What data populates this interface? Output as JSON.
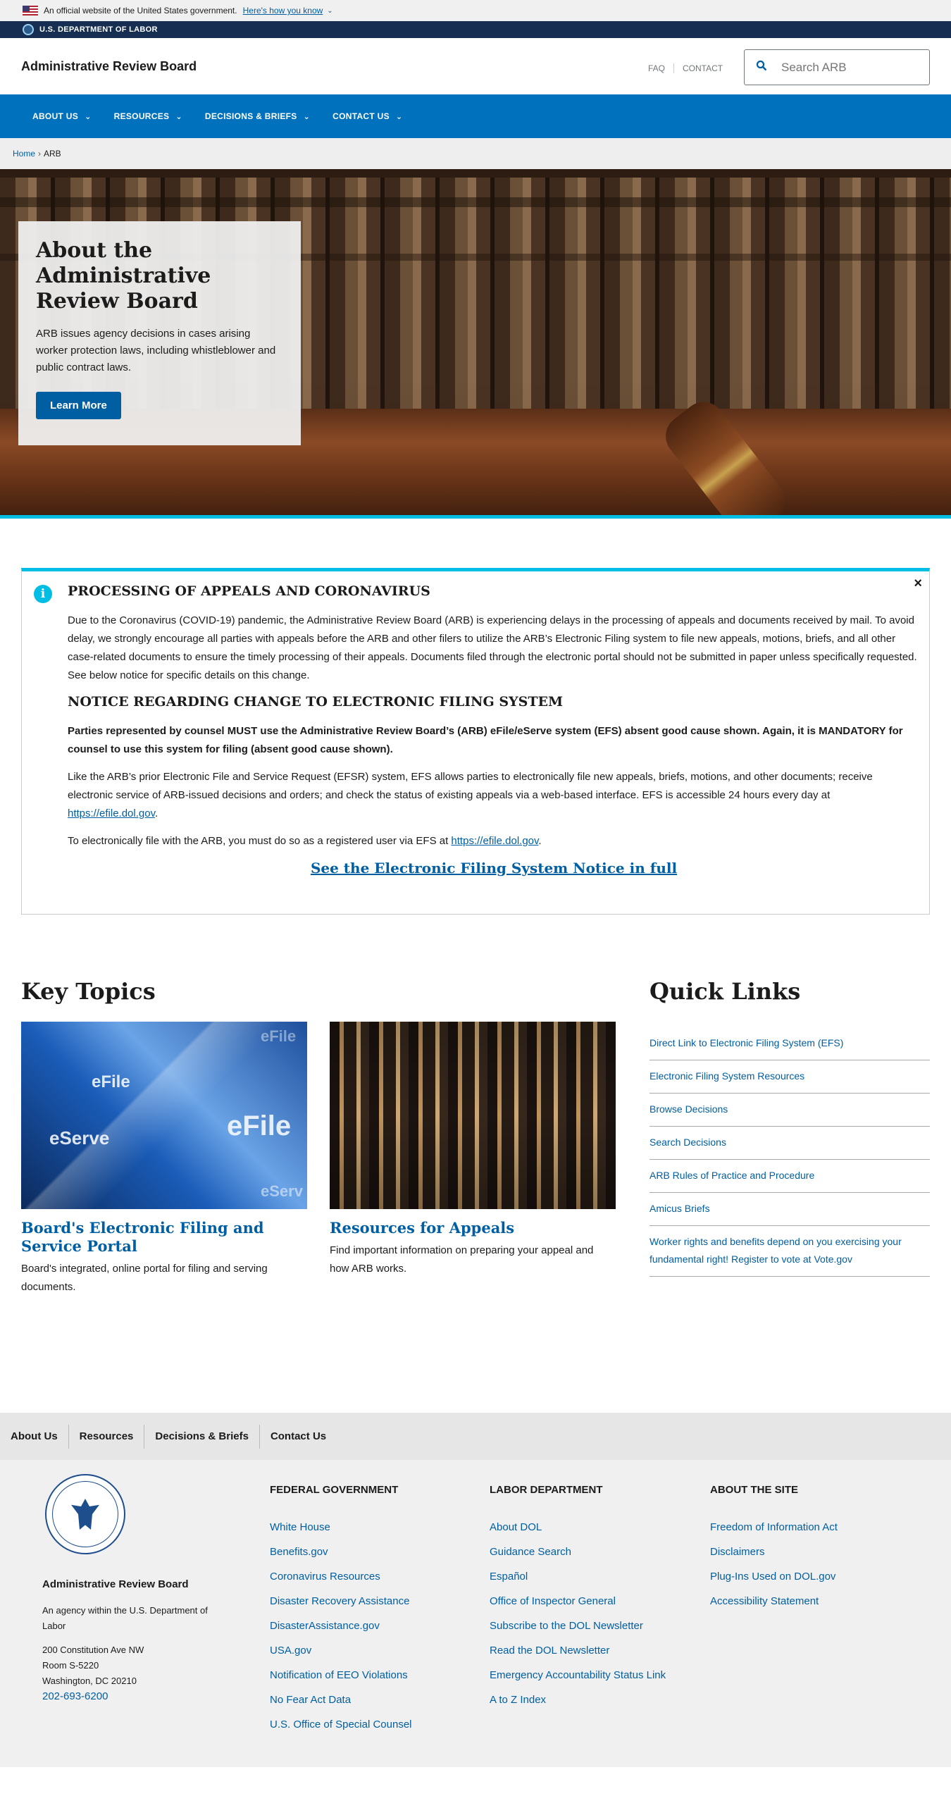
{
  "gov_banner": {
    "text": "An official website of the United States government.",
    "how_know": "Here's how you know"
  },
  "dol_bar": {
    "label": "U.S. DEPARTMENT OF LABOR"
  },
  "header": {
    "site_name": "Administrative Review Board",
    "util": {
      "faq": "FAQ",
      "contact": "CONTACT"
    },
    "search_placeholder": "Search ARB"
  },
  "nav": {
    "items": [
      {
        "label": "ABOUT US"
      },
      {
        "label": "RESOURCES"
      },
      {
        "label": "DECISIONS & BRIEFS"
      },
      {
        "label": "CONTACT US"
      }
    ]
  },
  "breadcrumb": {
    "home": "Home",
    "sep": "›",
    "current": "ARB"
  },
  "hero": {
    "title": "About the Administrative Review Board",
    "body": "ARB issues agency decisions in cases arising worker protection laws, including whistleblower and public contract laws.",
    "button": "Learn More"
  },
  "alert": {
    "close": "×",
    "heading1": "PROCESSING OF APPEALS AND CORONAVIRUS",
    "para1": "Due to the Coronavirus (COVID-19) pandemic, the Administrative Review Board (ARB) is experiencing delays in the processing of appeals and documents received by mail. To avoid delay, we strongly encourage all parties with appeals before the ARB and other filers to utilize the ARB’s Electronic Filing system to file new appeals, motions, briefs, and all other case-related documents to ensure the timely processing of their appeals. Documents filed through the electronic portal should not be submitted in paper unless specifically requested. See below notice for specific details on this change.",
    "heading2": "NOTICE REGARDING CHANGE TO ELECTRONIC FILING SYSTEM",
    "bold_para": "Parties represented by counsel MUST use the Administrative Review Board’s (ARB) eFile/eServe system (EFS) absent good cause shown. Again, it is MANDATORY for counsel to use this system for filing (absent good cause shown).",
    "para2": "Like the ARB’s prior Electronic File and Service Request (EFSR) system, EFS allows parties to electronically file new appeals, briefs, motions, and other documents; receive electronic service of ARB-issued decisions and orders; and check the status of existing appeals via a web-based interface. EFS is accessible 24 hours every day at",
    "para2_link": "https://efile.dol.gov",
    "para3": "To electronically file with the ARB, you must do so as a registered user via EFS at",
    "para3_link": "https://efile.dol.gov",
    "notice_link": "See the Electronic Filing System Notice in full"
  },
  "key_topics": {
    "title": "Key Topics",
    "items": [
      {
        "title": "Board's Electronic Filing and Service Portal",
        "desc": "Board's integrated, online portal for filing and serving documents.",
        "img_labels": [
          "eFile",
          "eServe",
          "eFile",
          "eFile",
          "eServ"
        ]
      },
      {
        "title": "Resources for Appeals",
        "desc": "Find important information on preparing your appeal and how ARB works."
      }
    ]
  },
  "quick_links": {
    "title": "Quick Links",
    "items": [
      "Direct Link to Electronic Filing System (EFS)",
      "Electronic Filing System Resources",
      "Browse Decisions",
      "Search Decisions",
      "ARB Rules of Practice and Procedure",
      "Amicus Briefs",
      "Worker rights and benefits depend on you exercising your fundamental right! Register to vote at Vote.gov"
    ]
  },
  "footer_nav": [
    "About Us",
    "Resources",
    "Decisions & Briefs",
    "Contact Us"
  ],
  "footer": {
    "agency_name": "Administrative Review Board",
    "agency_desc": "An agency within the U.S. Department of Labor",
    "address_line1": "200 Constitution Ave NW",
    "address_line2": "Room S-5220",
    "address_line3": "Washington, DC 20210",
    "phone": "202-693-6200",
    "columns": [
      {
        "title": "FEDERAL GOVERNMENT",
        "links": [
          "White House",
          "Benefits.gov",
          "Coronavirus Resources",
          "Disaster Recovery Assistance",
          "DisasterAssistance.gov",
          "USA.gov",
          "Notification of EEO Violations",
          "No Fear Act Data",
          "U.S. Office of Special Counsel"
        ]
      },
      {
        "title": "LABOR DEPARTMENT",
        "links": [
          "About DOL",
          "Guidance Search",
          "Español",
          "Office of Inspector General",
          "Subscribe to the DOL Newsletter",
          "Read the DOL Newsletter",
          "Emergency Accountability Status Link",
          "A to Z Index"
        ]
      },
      {
        "title": "ABOUT THE SITE",
        "links": [
          "Freedom of Information Act",
          "Disclaimers",
          "Plug-Ins Used on DOL.gov",
          "Accessibility Statement"
        ]
      }
    ]
  },
  "colors": {
    "primary": "#005ea2",
    "nav": "#0071bc",
    "dol_bar": "#162e51",
    "accent": "#00bde3"
  }
}
